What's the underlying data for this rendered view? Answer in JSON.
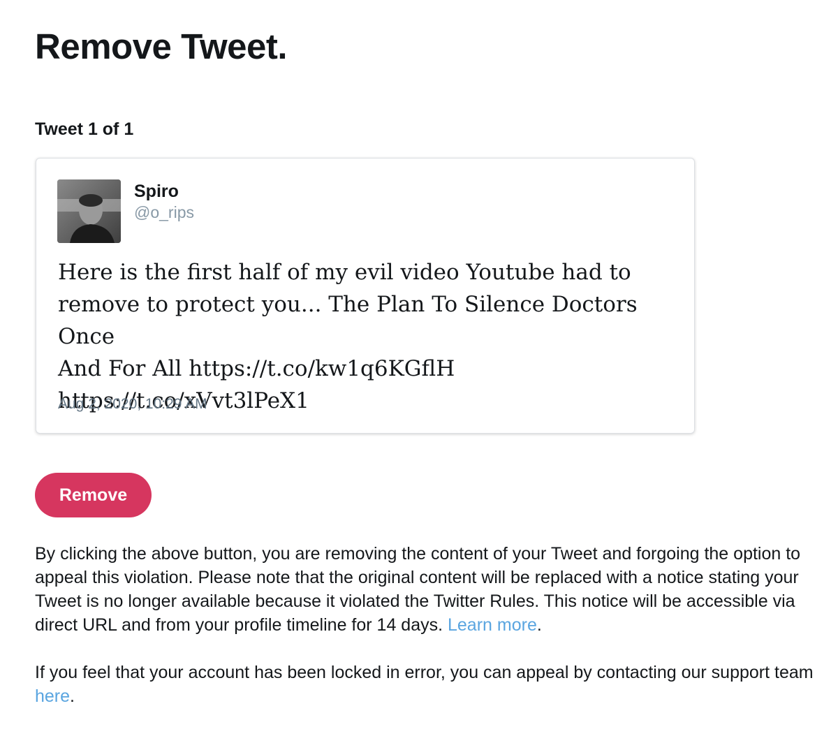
{
  "page": {
    "title": "Remove Tweet."
  },
  "tweet_counter": "Tweet 1 of 1",
  "tweet": {
    "display_name": "Spiro",
    "handle": "@o_rips",
    "text_lines": [
      "Here is the first half of my evil video Youtube had to",
      "remove to protect you... The Plan To Silence Doctors Once",
      "And For All https://t.co/kw1q6KGflH",
      "https://t.co/xVvt3lPeX1"
    ],
    "timestamp": "Aug 2, 2020, 10:29 AM",
    "avatar_icon": "user-avatar-photo"
  },
  "actions": {
    "remove_label": "Remove"
  },
  "notice": {
    "text": "By clicking the above button, you are removing the content of your Tweet and forgoing the option to appeal this violation. Please note that the original content will be replaced with a notice stating your Tweet is no longer available because it violated the Twitter Rules. This notice will be accessible via direct URL and from your profile timeline for 14 days. ",
    "learn_more_label": "Learn more",
    "suffix": "."
  },
  "appeal": {
    "text": "If you feel that your account has been locked in error, you can appeal by contacting our support team ",
    "link_label": "here",
    "suffix": "."
  },
  "colors": {
    "remove_button": "#d6365f",
    "link": "#5aa5e0",
    "handle": "#8899a6",
    "timestamp": "#657786"
  }
}
